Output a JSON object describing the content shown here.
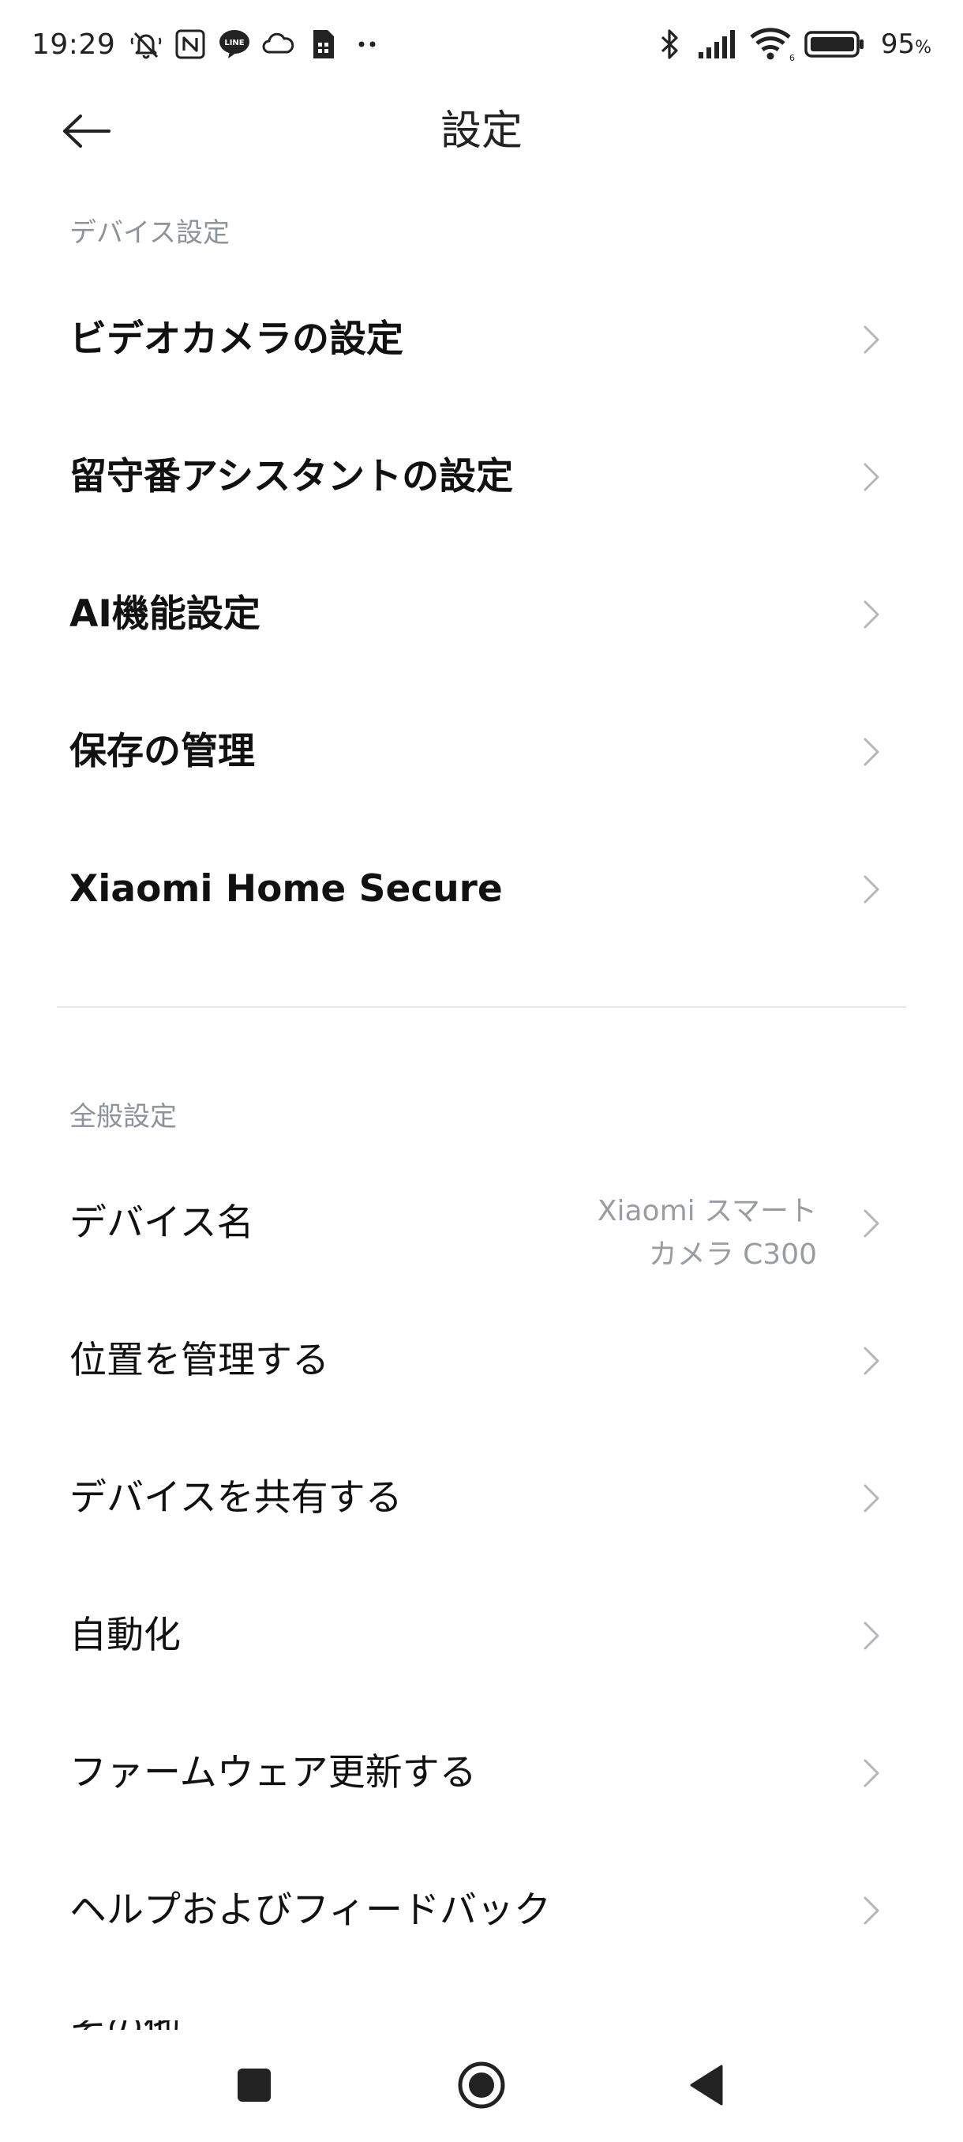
{
  "status_bar": {
    "time": "19:29",
    "battery_percent": "95",
    "battery_suffix": "%",
    "left_icons": [
      "mute-bell-icon",
      "nfc-icon",
      "line-app-icon",
      "cloud-icon",
      "sim-card-icon",
      "more-dots-icon"
    ],
    "right_icons": [
      "bluetooth-icon",
      "cellular-signal-icon",
      "wifi-icon",
      "battery-icon"
    ]
  },
  "header": {
    "title": "設定",
    "back_icon": "arrow-left-icon"
  },
  "device_section": {
    "label": "デバイス設定",
    "items": [
      {
        "label": "ビデオカメラの設定"
      },
      {
        "label": "留守番アシスタントの設定"
      },
      {
        "label": "AI機能設定"
      },
      {
        "label": "保存の管理"
      },
      {
        "label": "Xiaomi Home Secure"
      }
    ]
  },
  "general_section": {
    "label": "全般設定",
    "items": [
      {
        "label": "デバイス名",
        "value_line1": "Xiaomi スマート",
        "value_line2": "カメラ C300"
      },
      {
        "label": "位置を管理する"
      },
      {
        "label": "デバイスを共有する"
      },
      {
        "label": "自動化"
      },
      {
        "label": "ファームウェア更新する"
      },
      {
        "label": "ヘルプおよびフィードバック"
      }
    ],
    "partial_item": "その他の設定"
  },
  "nav_bar": {
    "icons": [
      "recents-square-icon",
      "home-circle-icon",
      "back-triangle-icon"
    ]
  },
  "colors": {
    "text_primary": "#111111",
    "section_label": "#8e929a",
    "secondary_value": "#9a9ca3",
    "chevron": "#b4b6bb",
    "divider": "#e7e7e7"
  }
}
